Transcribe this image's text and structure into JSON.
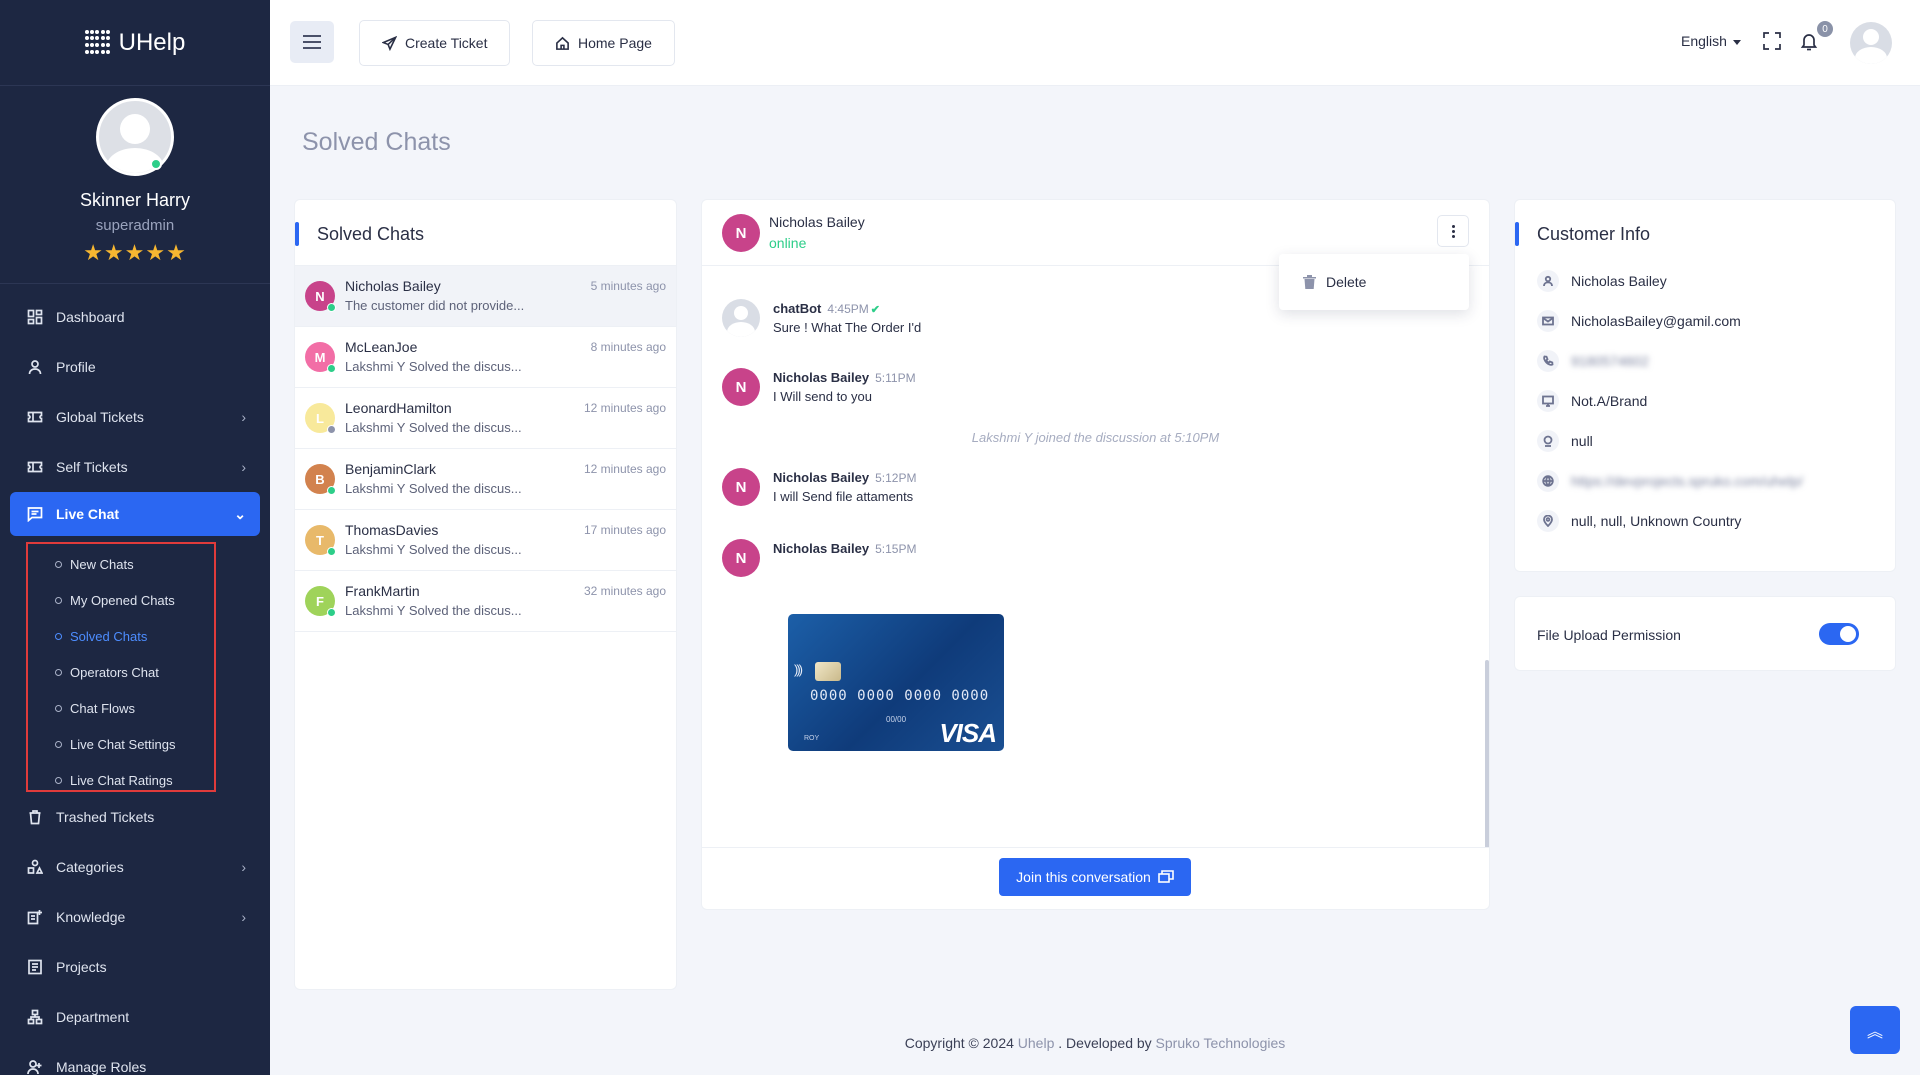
{
  "brand": {
    "name": "UHelp"
  },
  "user": {
    "name": "Skinner Harry",
    "role": "superadmin",
    "rating_stars": "★★★★★"
  },
  "sidebar": {
    "items": [
      {
        "label": "Dashboard",
        "icon": "dashboard-icon"
      },
      {
        "label": "Profile",
        "icon": "user-icon"
      },
      {
        "label": "Global Tickets",
        "icon": "ticket-icon",
        "expandable": true
      },
      {
        "label": "Self Tickets",
        "icon": "ticket-icon",
        "expandable": true
      },
      {
        "label": "Live Chat",
        "icon": "chat-icon",
        "expandable": true,
        "active": true
      },
      {
        "label": "Trashed Tickets",
        "icon": "trash-icon"
      },
      {
        "label": "Categories",
        "icon": "categories-icon",
        "expandable": true
      },
      {
        "label": "Knowledge",
        "icon": "knowledge-icon",
        "expandable": true
      },
      {
        "label": "Projects",
        "icon": "projects-icon"
      },
      {
        "label": "Department",
        "icon": "department-icon"
      },
      {
        "label": "Manage Roles",
        "icon": "roles-icon"
      }
    ],
    "live_chat_submenu": [
      "New Chats",
      "My Opened Chats",
      "Solved Chats",
      "Operators Chat",
      "Chat Flows",
      "Live Chat Settings",
      "Live Chat Ratings"
    ]
  },
  "header": {
    "create_ticket": "Create Ticket",
    "home_page": "Home Page",
    "language": "English",
    "notification_count": "0"
  },
  "page": {
    "title": "Solved Chats"
  },
  "chat_list": {
    "title": "Solved Chats",
    "chats": [
      {
        "initial": "N",
        "name": "Nicholas Bailey",
        "preview": "The customer did not provide...",
        "time": "5 minutes ago",
        "avatar_color": "#c8438a",
        "status_color": "#2dce89"
      },
      {
        "initial": "M",
        "name": "McLeanJoe",
        "preview": "Lakshmi Y Solved the discus...",
        "time": "8 minutes ago",
        "avatar_color": "#f26ea6",
        "status_color": "#2dce89"
      },
      {
        "initial": "L",
        "name": "LeonardHamilton",
        "preview": "Lakshmi Y Solved the discus...",
        "time": "12 minutes ago",
        "avatar_color": "#f8e99b",
        "status_color": "#8d93ab"
      },
      {
        "initial": "B",
        "name": "BenjaminClark",
        "preview": "Lakshmi Y Solved the discus...",
        "time": "12 minutes ago",
        "avatar_color": "#d2824e",
        "status_color": "#2dce89"
      },
      {
        "initial": "T",
        "name": "ThomasDavies",
        "preview": "Lakshmi Y Solved the discus...",
        "time": "17 minutes ago",
        "avatar_color": "#e8b96a",
        "status_color": "#2dce89"
      },
      {
        "initial": "F",
        "name": "FrankMartin",
        "preview": "Lakshmi Y Solved the discus...",
        "time": "32 minutes ago",
        "avatar_color": "#9fd35a",
        "status_color": "#2dce89"
      }
    ]
  },
  "conversation": {
    "contact_initial": "N",
    "contact_name": "Nicholas Bailey",
    "contact_status": "online",
    "menu_delete": "Delete",
    "messages": [
      {
        "sender": "chatBot",
        "time": "4:45PM",
        "text": "Sure ! What The Order I'd"
      },
      {
        "sender": "Nicholas Bailey",
        "time": "5:11PM",
        "text": "I Will send to you"
      },
      {
        "sender": "Nicholas Bailey",
        "time": "5:12PM",
        "text": "I will Send file attaments"
      },
      {
        "sender": "Nicholas Bailey",
        "time": "5:15PM",
        "text": ""
      }
    ],
    "system_note": "Lakshmi Y joined the discussion at 5:10PM",
    "attachment": {
      "card_number": "0000 0000 0000 0000",
      "expiry": "00/00",
      "holder": "ROY",
      "brand": "VISA"
    },
    "join_button": "Join this conversation"
  },
  "customer_info": {
    "title": "Customer Info",
    "name": "Nicholas Bailey",
    "email": "NicholasBailey@gamil.com",
    "phone": "9180574602",
    "device": "Not.A/Brand",
    "ip": "null",
    "url": "https://devprojects.spruko.com/uhelp/",
    "location": "null, null, Unknown Country"
  },
  "permissions": {
    "file_upload_label": "File Upload Permission",
    "file_upload_enabled": true
  },
  "footer": {
    "prefix": "Copyright © 2024 ",
    "brand": "Uhelp",
    "middle": " . Developed by ",
    "company": "Spruko Technologies"
  },
  "colors": {
    "accent": "#2b67f2",
    "sidebar_bg": "#1d2742",
    "online": "#2dce89",
    "highlight_border": "#e03b3b"
  }
}
